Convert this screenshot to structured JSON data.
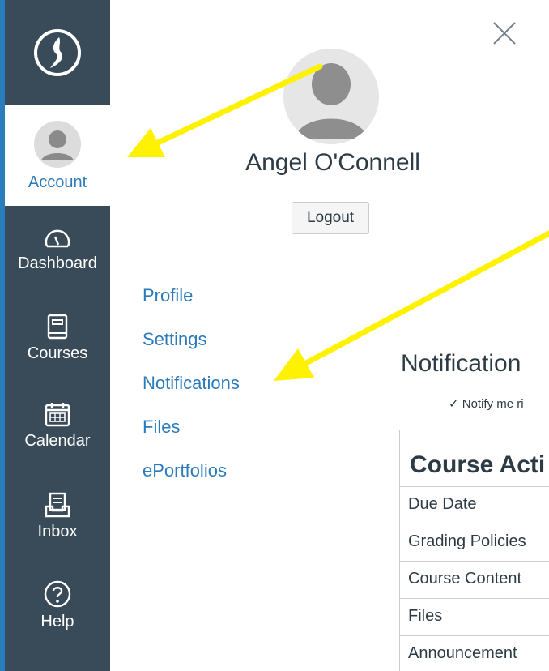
{
  "nav": {
    "items": [
      {
        "label": "Account",
        "icon": "avatar-icon",
        "active": true
      },
      {
        "label": "Dashboard",
        "icon": "dashboard-gauge-icon"
      },
      {
        "label": "Courses",
        "icon": "book-icon"
      },
      {
        "label": "Calendar",
        "icon": "calendar-icon"
      },
      {
        "label": "Inbox",
        "icon": "inbox-icon"
      },
      {
        "label": "Help",
        "icon": "help-icon"
      }
    ]
  },
  "tray": {
    "user_name": "Angel O'Connell",
    "logout_label": "Logout",
    "links": [
      "Profile",
      "Settings",
      "Notifications",
      "Files",
      "ePortfolios"
    ]
  },
  "page": {
    "title": "Notification",
    "notify_text": "✓ Notify me ri",
    "table": {
      "header": "Course Acti",
      "rows": [
        "Due Date",
        "Grading Policies",
        "Course Content",
        "Files",
        "Announcement"
      ]
    }
  },
  "colors": {
    "nav_bg": "#394b58",
    "link": "#2b7abc",
    "arrow": "#fff200",
    "text": "#2d3b45"
  }
}
